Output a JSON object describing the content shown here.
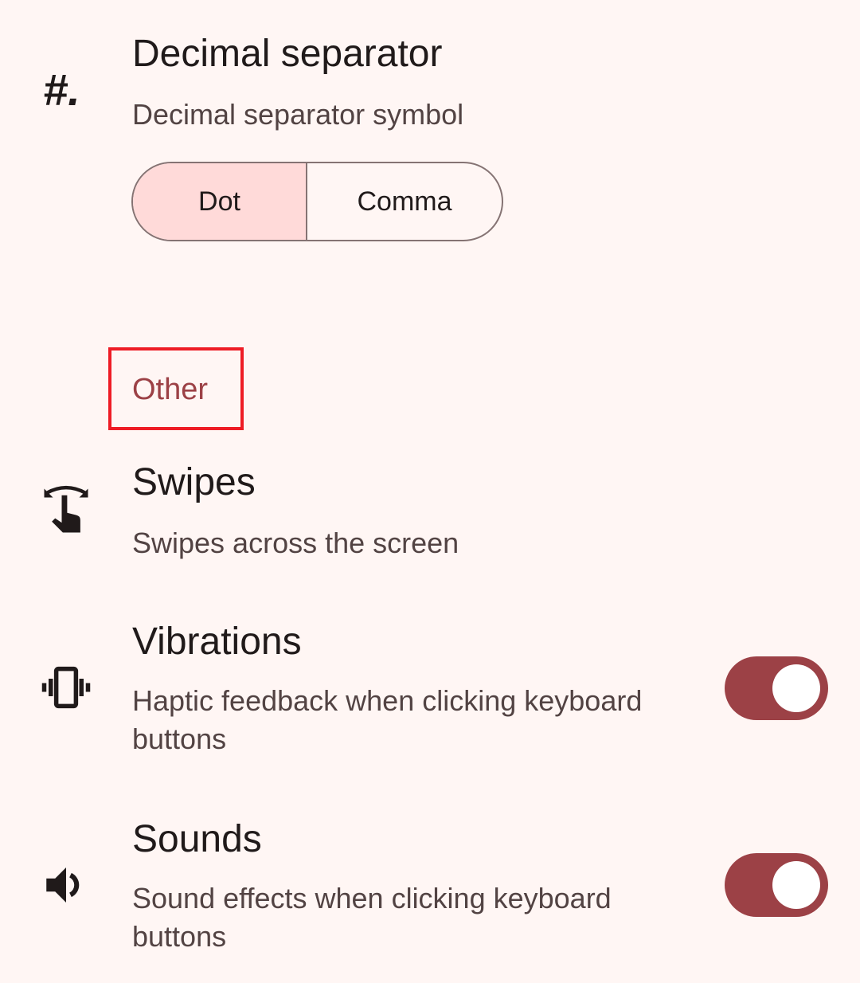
{
  "decimal": {
    "title": "Decimal separator",
    "subtitle": "Decimal separator symbol",
    "icon": "hash-dot-icon",
    "options": [
      "Dot",
      "Comma"
    ],
    "selected": "Dot"
  },
  "section": {
    "label": "Other",
    "color": "#9c4146"
  },
  "swipes": {
    "title": "Swipes",
    "subtitle": "Swipes across the screen",
    "icon": "swipe-icon"
  },
  "vibrations": {
    "title": "Vibrations",
    "subtitle": "Haptic feedback when clicking keyboard buttons",
    "icon": "vibration-icon",
    "enabled": true
  },
  "sounds": {
    "title": "Sounds",
    "subtitle": "Sound effects when clicking keyboard buttons",
    "icon": "volume-icon",
    "enabled": true
  },
  "colors": {
    "background": "#fff6f4",
    "accent": "#9c4146",
    "selected_segment": "#ffdad9",
    "highlight": "#ee1c25"
  }
}
